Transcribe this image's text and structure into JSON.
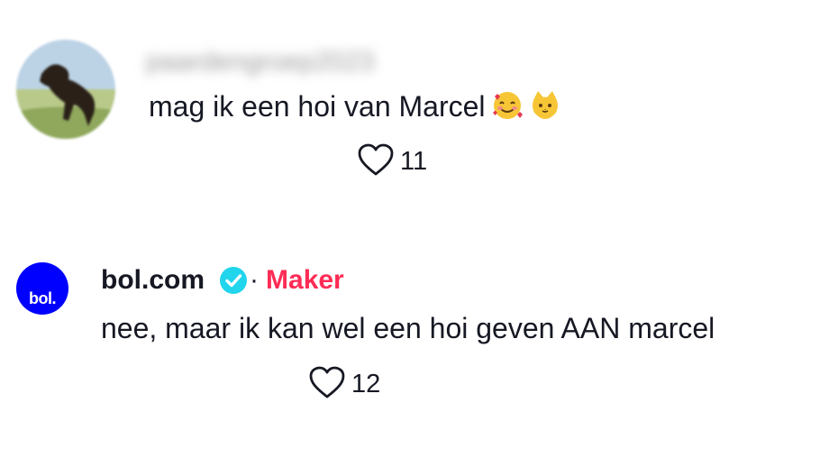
{
  "comments": [
    {
      "username": "paardengroep2023",
      "text": "mag ik een hoi van Marcel",
      "emojis": [
        "smiling-face-with-hearts",
        "cat-face"
      ],
      "likes": "11"
    },
    {
      "username": "bol.com",
      "verified": true,
      "separator": "·",
      "role": "Maker",
      "avatar_logo": "bol.",
      "text": "nee, maar ik kan wel een hoi geven AAN marcel",
      "likes": "12"
    }
  ],
  "colors": {
    "text": "#161823",
    "maker": "#fe2c55",
    "verified": "#20d5ec",
    "bol_blue": "#0000ff"
  }
}
